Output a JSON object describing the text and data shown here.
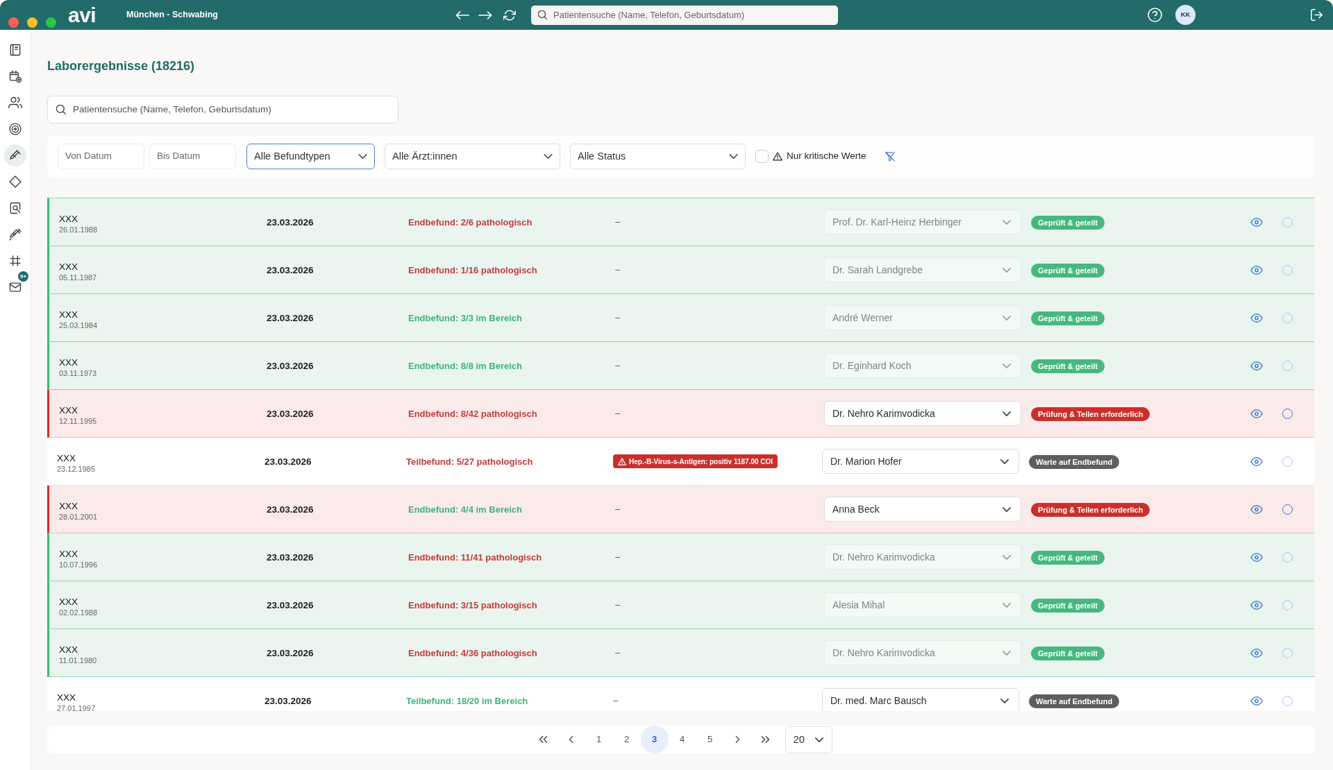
{
  "top_bar": {
    "logo": "avi",
    "location": "München - Schwabing",
    "search": {
      "placeholder": "Patientensuche (Name, Telefon, Geburtsdatum)"
    },
    "user": {
      "initials": "KK"
    }
  },
  "sidebar": {
    "items": [
      {
        "selected": false
      },
      {
        "selected": false
      },
      {
        "selected": false
      },
      {
        "selected": false
      },
      {
        "selected": true
      },
      {
        "selected": false
      },
      {
        "selected": false
      },
      {
        "selected": false
      },
      {
        "selected": false
      },
      {
        "selected": false,
        "badge": "9+"
      }
    ]
  },
  "page": {
    "title": "Laborergebnisse (18216)"
  },
  "search": {
    "placeholder": "Patientensuche (Name, Telefon, Geburtsdatum)"
  },
  "filters": {
    "from_date": {
      "placeholder": "Von Datum"
    },
    "to_date": {
      "placeholder": "Bis Datum"
    },
    "selects": [
      {
        "value": "Alle Befundtypen",
        "focused": true
      },
      {
        "value": "Alle Ärzt:innen",
        "focused": false
      },
      {
        "value": "Alle Status",
        "focused": false
      }
    ],
    "critical_only": {
      "label": "Nur kritische Werte",
      "checked": false
    }
  },
  "table": {
    "rows": [
      {
        "kind": "shared",
        "name": "XXX",
        "birth_date": "26.01.1988",
        "date": "23.03.2026",
        "result": {
          "text": "Endbefund: 2/6 pathologisch",
          "pathological": true
        },
        "critical": {
          "text": "–",
          "alert": false
        },
        "doctor": {
          "value": "Prof. Dr. Karl-Heinz Herbinger",
          "disabled": true
        },
        "status": {
          "text": "Geprüft & geteilt",
          "kind": "shared"
        },
        "checkbox": {
          "checked": false,
          "disabled": true
        }
      },
      {
        "kind": "shared",
        "name": "XXX",
        "birth_date": "05.11.1987",
        "date": "23.03.2026",
        "result": {
          "text": "Endbefund: 1/16 pathologisch",
          "pathological": true
        },
        "critical": {
          "text": "–",
          "alert": false
        },
        "doctor": {
          "value": "Dr. Sarah Landgrebe",
          "disabled": true
        },
        "status": {
          "text": "Geprüft & geteilt",
          "kind": "shared"
        },
        "checkbox": {
          "checked": false,
          "disabled": true
        }
      },
      {
        "kind": "shared",
        "name": "XXX",
        "birth_date": "25.03.1984",
        "date": "23.03.2026",
        "result": {
          "text": "Endbefund: 3/3 im Bereich",
          "pathological": false
        },
        "critical": {
          "text": "–",
          "alert": false
        },
        "doctor": {
          "value": "André Werner",
          "disabled": true
        },
        "status": {
          "text": "Geprüft & geteilt",
          "kind": "shared"
        },
        "checkbox": {
          "checked": false,
          "disabled": true
        }
      },
      {
        "kind": "shared",
        "name": "XXX",
        "birth_date": "03.11.1973",
        "date": "23.03.2026",
        "result": {
          "text": "Endbefund: 8/8 im Bereich",
          "pathological": false
        },
        "critical": {
          "text": "–",
          "alert": false
        },
        "doctor": {
          "value": "Dr. Eginhard Koch",
          "disabled": true
        },
        "status": {
          "text": "Geprüft & geteilt",
          "kind": "shared"
        },
        "checkbox": {
          "checked": false,
          "disabled": true
        }
      },
      {
        "kind": "review",
        "name": "XXX",
        "birth_date": "12.11.1995",
        "date": "23.03.2026",
        "result": {
          "text": "Endbefund: 8/42 pathologisch",
          "pathological": true
        },
        "critical": {
          "text": "–",
          "alert": false
        },
        "doctor": {
          "value": "Dr. Nehro Karimvodicka",
          "disabled": false
        },
        "status": {
          "text": "Prüfung & Teilen erforderlich",
          "kind": "review"
        },
        "checkbox": {
          "checked": false,
          "disabled": false
        }
      },
      {
        "kind": "waiting",
        "name": "XXX",
        "birth_date": "23.12.1985",
        "date": "23.03.2026",
        "result": {
          "text": "Teilbefund: 5/27 pathologisch",
          "pathological": true
        },
        "critical": {
          "text": "Hep.-B-Virus-s-Antigen: positiv 1187.00 COI",
          "alert": true
        },
        "doctor": {
          "value": "Dr. Marion Hofer",
          "disabled": false
        },
        "status": {
          "text": "Warte auf Endbefund",
          "kind": "waiting"
        },
        "checkbox": {
          "checked": false,
          "disabled": true
        }
      },
      {
        "kind": "review",
        "name": "XXX",
        "birth_date": "28.01.2001",
        "date": "23.03.2026",
        "result": {
          "text": "Endbefund: 4/4 im Bereich",
          "pathological": false
        },
        "critical": {
          "text": "–",
          "alert": false
        },
        "doctor": {
          "value": "Anna Beck",
          "disabled": false
        },
        "status": {
          "text": "Prüfung & Teilen erforderlich",
          "kind": "review"
        },
        "checkbox": {
          "checked": false,
          "disabled": false
        }
      },
      {
        "kind": "shared",
        "name": "XXX",
        "birth_date": "10.07.1996",
        "date": "23.03.2026",
        "result": {
          "text": "Endbefund: 11/41 pathologisch",
          "pathological": true
        },
        "critical": {
          "text": "–",
          "alert": false
        },
        "doctor": {
          "value": "Dr. Nehro Karimvodicka",
          "disabled": true
        },
        "status": {
          "text": "Geprüft & geteilt",
          "kind": "shared"
        },
        "checkbox": {
          "checked": false,
          "disabled": true
        }
      },
      {
        "kind": "shared",
        "name": "XXX",
        "birth_date": "02.02.1988",
        "date": "23.03.2026",
        "result": {
          "text": "Endbefund: 3/15 pathologisch",
          "pathological": true
        },
        "critical": {
          "text": "–",
          "alert": false
        },
        "doctor": {
          "value": "Alesia Mihal",
          "disabled": true
        },
        "status": {
          "text": "Geprüft & geteilt",
          "kind": "shared"
        },
        "checkbox": {
          "checked": false,
          "disabled": true
        }
      },
      {
        "kind": "shared",
        "name": "XXX",
        "birth_date": "11.01.1980",
        "date": "23.03.2026",
        "result": {
          "text": "Endbefund: 4/36 pathologisch",
          "pathological": true
        },
        "critical": {
          "text": "–",
          "alert": false
        },
        "doctor": {
          "value": "Dr. Nehro Karimvodicka",
          "disabled": true
        },
        "status": {
          "text": "Geprüft & geteilt",
          "kind": "shared"
        },
        "checkbox": {
          "checked": false,
          "disabled": true
        }
      },
      {
        "kind": "waiting",
        "name": "XXX",
        "birth_date": "27.01.1997",
        "date": "23.03.2026",
        "result": {
          "text": "Teilbefund: 18/20 im Bereich",
          "pathological": false
        },
        "critical": {
          "text": "–",
          "alert": false
        },
        "doctor": {
          "value": "Dr. med. Marc Bausch",
          "disabled": false
        },
        "status": {
          "text": "Warte auf Endbefund",
          "kind": "waiting"
        },
        "checkbox": {
          "checked": false,
          "disabled": true
        }
      }
    ]
  },
  "pagination": {
    "pages": [
      {
        "label": "1",
        "selected": false
      },
      {
        "label": "2",
        "selected": false
      },
      {
        "label": "3",
        "selected": true
      },
      {
        "label": "4",
        "selected": false
      },
      {
        "label": "5",
        "selected": false
      }
    ],
    "page_size": "20"
  }
}
